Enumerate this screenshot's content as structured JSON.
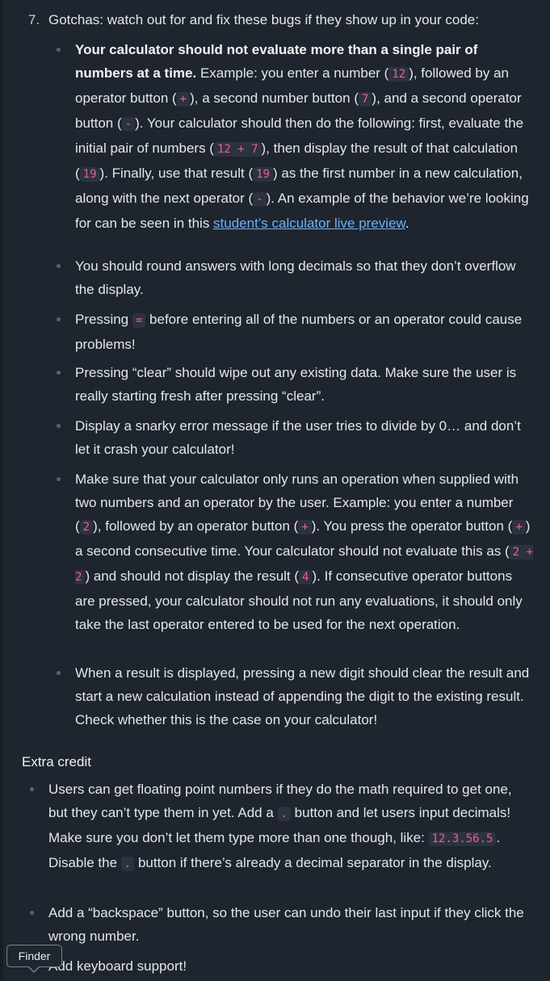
{
  "list": {
    "number": "7.",
    "title": "Gotchas: watch out for and fix these bugs if they show up in your code:"
  },
  "gotchas": {
    "b1": {
      "bold": "Your calculator should not evaluate more than a single pair of numbers at a time.",
      "t1": " Example: you enter a number (",
      "c1": "12",
      "t2": "), followed by an operator button (",
      "c2": "+",
      "t3": "), a second number button (",
      "c3": "7",
      "t4": "), and a second operator button (",
      "c4": "-",
      "t5": "). Your calculator should then do the following: first, evaluate the initial pair of numbers (",
      "c5": "12 + 7",
      "t6": "), then display the result of that calculation (",
      "c6": "19",
      "t7": "). Finally, use that result (",
      "c7": "19",
      "t8": ") as the first number in a new calculation, along with the next operator (",
      "c8": "-",
      "t9": "). An example of the behavior we’re looking for can be seen in this ",
      "link": "student’s calculator live preview",
      "t10": "."
    },
    "b2": "You should round answers with long decimals so that they don’t overflow the display.",
    "b3": {
      "t1": "Pressing ",
      "c1": "=",
      "t2": " before entering all of the numbers or an operator could cause problems!"
    },
    "b4": "Pressing “clear” should wipe out any existing data. Make sure the user is really starting fresh after pressing “clear”.",
    "b5": "Display a snarky error message if the user tries to divide by 0… and don’t let it crash your calculator!",
    "b6": {
      "t1": "Make sure that your calculator only runs an operation when supplied with two numbers and an operator by the user. Example: you enter a number (",
      "c1": "2",
      "t2": "), followed by an operator button (",
      "c2": "+",
      "t3": "). You press the operator button (",
      "c3": "+",
      "t4": ") a second consecutive time. Your calculator should not evaluate this as (",
      "c4": "2 + 2",
      "t5": ") and should not display the result (",
      "c5": "4",
      "t6": "). If consecutive operator buttons are pressed, your calculator should not run any evaluations, it should only take the last operator entered to be used for the next operation."
    },
    "b7": "When a result is displayed, pressing a new digit should clear the result and start a new calculation instead of appending the digit to the existing result. Check whether this is the case on your calculator!"
  },
  "extra": {
    "heading": "Extra credit",
    "e1": {
      "t1": "Users can get floating point numbers if they do the math required to get one, but they can’t type them in yet. Add a ",
      "c1": ".",
      "t2": " button and let users input decimals! Make sure you don’t let them type more than one though, like: ",
      "c2": "12.3.56.5",
      "t3": ". Disable the ",
      "c3": ".",
      "t4": " button if there’s already a decimal separator in the display."
    },
    "e2": "Add a “backspace” button, so the user can undo their last input if they click the wrong number.",
    "e3": "Add keyboard support!"
  },
  "tooltip": {
    "label": "Finder"
  }
}
